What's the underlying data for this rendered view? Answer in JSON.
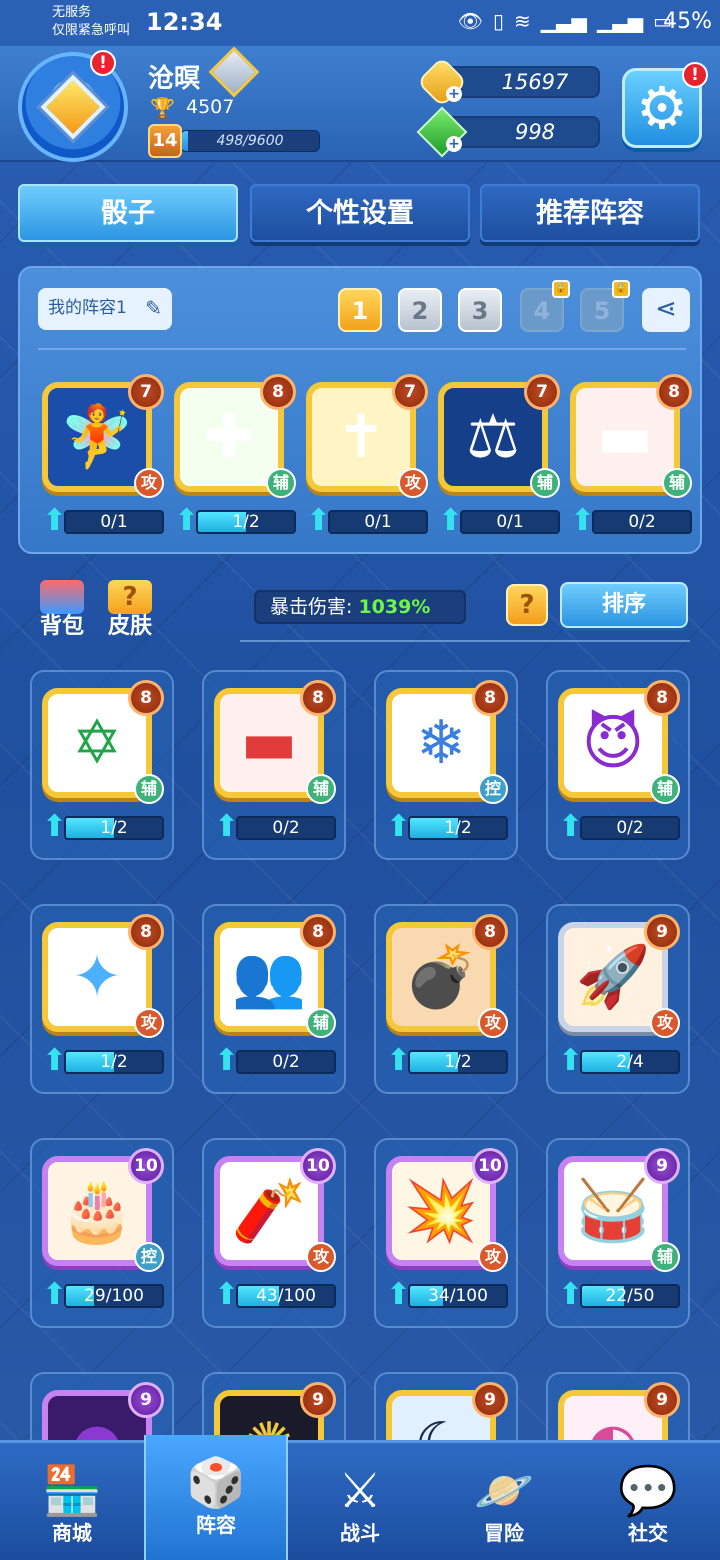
{
  "status_bar": {
    "carrier_line1": "无服务",
    "carrier_line2": "仅限紧急呼叫",
    "time": "12:34",
    "battery": "45%"
  },
  "player": {
    "name": "沧暝",
    "trophies": "4507",
    "level": "14",
    "xp": "498/9600",
    "xp_progress": 0.052,
    "avatar_alert": "!"
  },
  "currency": {
    "gold": "15697",
    "gems": "998"
  },
  "settings_alert": "!",
  "tabs": [
    {
      "label": "骰子",
      "active": true
    },
    {
      "label": "个性设置",
      "active": false
    },
    {
      "label": "推荐阵容",
      "active": false
    }
  ],
  "lineup": {
    "name": "我的阵容1",
    "slots": [
      "1",
      "2",
      "3",
      "4",
      "5"
    ],
    "active_slot": "1",
    "locked_slots": [
      "4",
      "5"
    ],
    "dice": [
      {
        "icon": "angel-icon",
        "glyph": "🧚",
        "bg": "#1b4ea8",
        "level": "7",
        "role": "攻",
        "role_type": "atk",
        "progress": "0/1",
        "fill": 0
      },
      {
        "icon": "heal-crosses-icon",
        "glyph": "✚",
        "bg": "#f4fff0",
        "level": "8",
        "role": "辅",
        "role_type": "sup",
        "progress": "1/2",
        "fill": 0.5
      },
      {
        "icon": "holy-cross-icon",
        "glyph": "✝",
        "bg": "#fff4c4",
        "level": "7",
        "role": "攻",
        "role_type": "atk",
        "progress": "0/1",
        "fill": 0
      },
      {
        "icon": "scales-icon",
        "glyph": "⚖",
        "bg": "#163f8a",
        "level": "7",
        "role": "辅",
        "role_type": "sup",
        "progress": "0/1",
        "fill": 0
      },
      {
        "icon": "red-block-icon",
        "glyph": "▬",
        "bg": "#fff0f0",
        "level": "8",
        "role": "辅",
        "role_type": "sup",
        "progress": "0/2",
        "fill": 0
      }
    ]
  },
  "toolbar": {
    "bag": "背包",
    "skin": "皮肤",
    "crit_label": "暴击伤害:",
    "crit_value": "1039%",
    "help": "?",
    "sort": "排序"
  },
  "collection": [
    {
      "icon": "magic-circle-icon",
      "glyph": "✡",
      "glyph_color": "#1fa548",
      "bg": "#ffffff",
      "frame": "gold",
      "level": "8",
      "role": "辅",
      "role_type": "sup",
      "progress": "1/2",
      "fill": 0.5
    },
    {
      "icon": "red-block-icon",
      "glyph": "▬",
      "glyph_color": "#e03a3a",
      "bg": "#fff0f0",
      "frame": "gold",
      "level": "8",
      "role": "辅",
      "role_type": "sup",
      "progress": "0/2",
      "fill": 0
    },
    {
      "icon": "snowflake-icon",
      "glyph": "❄",
      "glyph_color": "#3a7ee0",
      "bg": "#ffffff",
      "frame": "gold",
      "level": "8",
      "role": "控",
      "role_type": "ctl",
      "progress": "1/2",
      "fill": 0.5
    },
    {
      "icon": "demon-icon",
      "glyph": "😈",
      "glyph_color": "#8a2bd0",
      "bg": "#ffffff",
      "frame": "gold",
      "level": "8",
      "role": "辅",
      "role_type": "sup",
      "progress": "0/2",
      "fill": 0
    },
    {
      "icon": "ice-crystal-icon",
      "glyph": "✦",
      "glyph_color": "#4ab0ff",
      "bg": "#ffffff",
      "frame": "gold",
      "level": "8",
      "role": "攻",
      "role_type": "atk",
      "progress": "1/2",
      "fill": 0.5
    },
    {
      "icon": "twins-icon",
      "glyph": "👥",
      "glyph_color": "#d96a2a",
      "bg": "#ffffff",
      "frame": "gold",
      "level": "8",
      "role": "辅",
      "role_type": "sup",
      "progress": "0/2",
      "fill": 0
    },
    {
      "icon": "bomb-icon",
      "glyph": "💣",
      "glyph_color": "#9a3ad0",
      "bg": "#f8d9b0",
      "frame": "gold",
      "level": "8",
      "role": "攻",
      "role_type": "atk",
      "progress": "1/2",
      "fill": 0.5
    },
    {
      "icon": "rocket-icon",
      "glyph": "🚀",
      "glyph_color": "#d9382a",
      "bg": "#fff0e0",
      "frame": "silver",
      "level": "9",
      "role": "攻",
      "role_type": "atk",
      "progress": "2/4",
      "fill": 0.5
    },
    {
      "icon": "cake-icon",
      "glyph": "🎂",
      "glyph_color": "#e07a2a",
      "bg": "#fff4e4",
      "frame": "purple",
      "level": "10",
      "role": "控",
      "role_type": "ctl",
      "progress": "29/100",
      "fill": 0.29
    },
    {
      "icon": "firecracker-icon",
      "glyph": "🧨",
      "glyph_color": "#d9282a",
      "bg": "#ffffff",
      "frame": "purple",
      "level": "10",
      "role": "攻",
      "role_type": "atk",
      "progress": "43/100",
      "fill": 0.43
    },
    {
      "icon": "explosion-icon",
      "glyph": "💥",
      "glyph_color": "#d99a2a",
      "bg": "#fff6e4",
      "frame": "purple",
      "level": "10",
      "role": "攻",
      "role_type": "atk",
      "progress": "34/100",
      "fill": 0.34
    },
    {
      "icon": "drum-icon",
      "glyph": "🥁",
      "glyph_color": "#c0282a",
      "bg": "#ffffff",
      "frame": "purple",
      "level": "9",
      "role": "辅",
      "role_type": "sup",
      "progress": "22/50",
      "fill": 0.44
    },
    {
      "icon": "purple-dice-icon",
      "glyph": "●",
      "glyph_color": "#8a3ad0",
      "bg": "#3a1a6a",
      "frame": "purple",
      "level": "9",
      "role": "",
      "role_type": "",
      "progress": "",
      "fill": 0
    },
    {
      "icon": "dark-rune-icon",
      "glyph": "✺",
      "glyph_color": "#f0c83a",
      "bg": "#1a1a2a",
      "frame": "gold",
      "level": "9",
      "role": "",
      "role_type": "",
      "progress": "",
      "fill": 0
    },
    {
      "icon": "moon-icon",
      "glyph": "☾",
      "glyph_color": "#1a2a4a",
      "bg": "#e0f0ff",
      "frame": "gold",
      "level": "9",
      "role": "",
      "role_type": "",
      "progress": "",
      "fill": 0
    },
    {
      "icon": "pink-dice-icon",
      "glyph": "◐",
      "glyph_color": "#d94a9a",
      "bg": "#fff0f8",
      "frame": "gold",
      "level": "9",
      "role": "",
      "role_type": "",
      "progress": "",
      "fill": 0
    }
  ],
  "nav": [
    {
      "label": "商城",
      "icon": "shop-icon",
      "glyph": "🏪",
      "active": false
    },
    {
      "label": "阵容",
      "icon": "dice-icon",
      "glyph": "🎲",
      "active": true
    },
    {
      "label": "战斗",
      "icon": "swords-icon",
      "glyph": "⚔",
      "active": false
    },
    {
      "label": "冒险",
      "icon": "planet-icon",
      "glyph": "🪐",
      "active": false
    },
    {
      "label": "社交",
      "icon": "chat-icon",
      "glyph": "💬",
      "active": false
    }
  ]
}
